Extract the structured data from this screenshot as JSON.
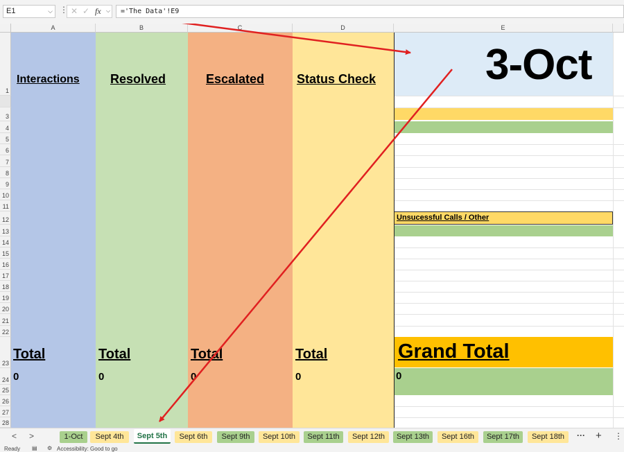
{
  "formula_bar": {
    "name_box": "E1",
    "formula": "='The Data'!E9",
    "fx_icon": "fx"
  },
  "columns": [
    "A",
    "B",
    "C",
    "D",
    "E"
  ],
  "row_numbers": [
    "1",
    "3",
    "4",
    "5",
    "6",
    "7",
    "8",
    "9",
    "10",
    "11",
    "12",
    "13",
    "14",
    "15",
    "16",
    "17",
    "18",
    "19",
    "20",
    "21",
    "22",
    "23",
    "24",
    "25",
    "26",
    "27",
    "28"
  ],
  "headers": {
    "interactions": "Interactions",
    "resolved": "Resolved",
    "escalated": "Escalated",
    "status_check": "Status Check",
    "date": "3-Oct"
  },
  "cells": {
    "unsuccessful": "Unsucessful Calls / Other",
    "grand_total": "Grand Total",
    "grand_value": "0"
  },
  "totals": {
    "label": "Total",
    "a": "0",
    "b": "0",
    "c": "0",
    "d": "0"
  },
  "tabs": {
    "prev": "<",
    "next": ">",
    "items": [
      {
        "label": "1-Oct",
        "color": "green"
      },
      {
        "label": "Sept 4th",
        "color": "yellow"
      },
      {
        "label": "Sept 5th",
        "color": "active"
      },
      {
        "label": "Sept 6th",
        "color": "yellow"
      },
      {
        "label": "Sept 9th",
        "color": "green"
      },
      {
        "label": "Sept 10th",
        "color": "yellow"
      },
      {
        "label": "Sept 11th",
        "color": "green"
      },
      {
        "label": "Sept 12th",
        "color": "yellow"
      },
      {
        "label": "Sept 13th",
        "color": "green"
      },
      {
        "label": "Sept 16th",
        "color": "yellow"
      },
      {
        "label": "Sept 17th",
        "color": "green"
      },
      {
        "label": "Sept 18th",
        "color": "yellow"
      }
    ],
    "more": "···",
    "add": "+",
    "menu": "⋮"
  },
  "status_bar": {
    "ready": "Ready",
    "accessibility": "Accessibility: Good to go"
  },
  "colors": {
    "col_a": "#b4c6e7",
    "col_b": "#c6e0b4",
    "col_c": "#f4b183",
    "col_d": "#ffe699",
    "date_cell": "#ddebf7",
    "yellow_band": "#ffd966",
    "green_band": "#a9d08e",
    "grand_total": "#ffc000",
    "arrow": "#e02020"
  }
}
